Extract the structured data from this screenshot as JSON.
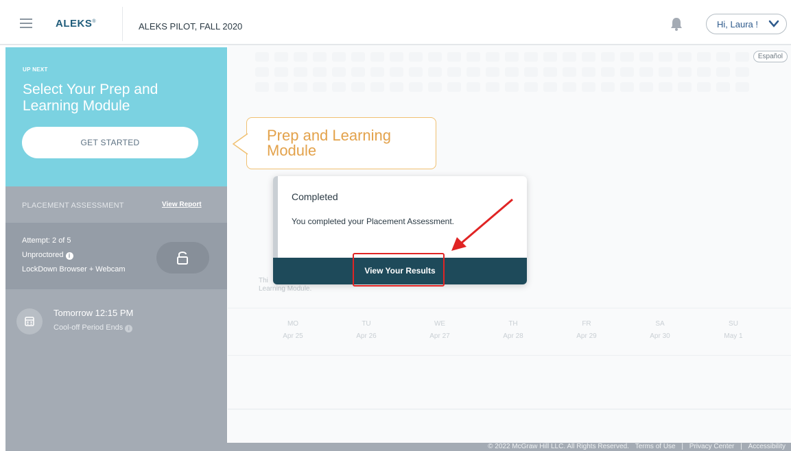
{
  "header": {
    "logo": "ALEKS",
    "logo_mark": "®",
    "course_title": "ALEKS PILOT, FALL 2020",
    "user_greeting": "Hi, Laura !"
  },
  "language_toggle": "Español",
  "up_next": {
    "label": "UP NEXT",
    "title": "Select Your Prep and Learning Module",
    "button": "GET STARTED"
  },
  "placement": {
    "label": "PLACEMENT ASSESSMENT",
    "view_report": "View Report",
    "attempt": "Attempt: 2 of 5",
    "proctor": "Unproctored",
    "browser": "LockDown Browser + Webcam"
  },
  "cooloff": {
    "time": "Tomorrow 12:15 PM",
    "label": "Cool-off Period Ends"
  },
  "callout": {
    "text": "Prep and Learning Module"
  },
  "card": {
    "title": "Completed",
    "body": "You completed your Placement Assessment.",
    "button": "View Your Results"
  },
  "background_text": {
    "line1": "Thi",
    "line2": "Learning Module."
  },
  "calendar": [
    {
      "day": "MO",
      "date": "Apr 25"
    },
    {
      "day": "TU",
      "date": "Apr 26"
    },
    {
      "day": "WE",
      "date": "Apr 27"
    },
    {
      "day": "TH",
      "date": "Apr 28"
    },
    {
      "day": "FR",
      "date": "Apr 29"
    },
    {
      "day": "SA",
      "date": "Apr 30"
    },
    {
      "day": "SU",
      "date": "May 1"
    }
  ],
  "footer": {
    "copyright": "© 2022 McGraw Hill LLC. All Rights Reserved.",
    "terms": "Terms of Use",
    "privacy": "Privacy Center",
    "accessibility": "Accessibility"
  },
  "icons": [
    "hamburger-menu-icon",
    "bell-icon",
    "chevron-down-icon",
    "lock-icon",
    "calendar-icon",
    "info-icon"
  ],
  "colors": {
    "up_next_bg": "#7bd2e1",
    "sidebar_bg": "#a4abb4",
    "card_footer": "#1e4a5a",
    "callout": "#e3a24b",
    "annotation": "#e02424"
  }
}
